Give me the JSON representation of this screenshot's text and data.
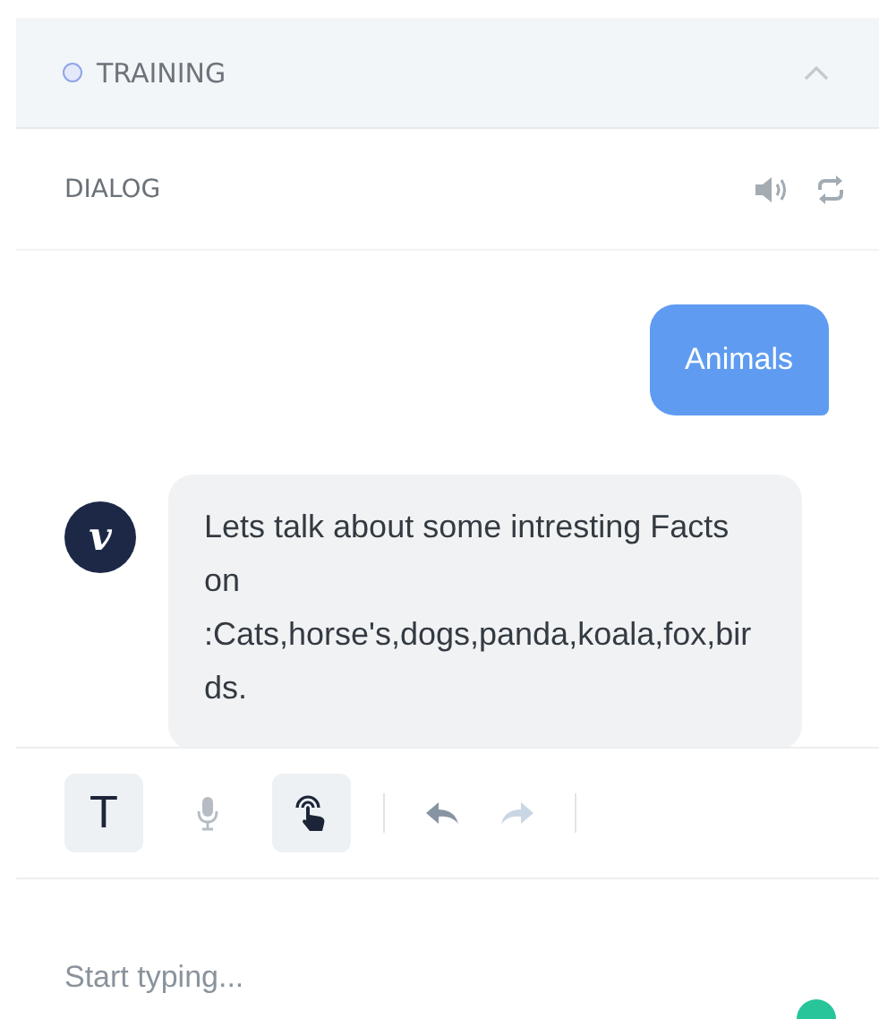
{
  "section": {
    "title": "TRAINING",
    "expanded": true
  },
  "dialog": {
    "title": "DIALOG"
  },
  "messages": [
    {
      "kind": "user",
      "text": "Animals"
    },
    {
      "kind": "bot",
      "avatar": "v",
      "text": "Lets talk about some intresting Facts on :Cats,horse's,dogs,panda,koala,fox,birds."
    }
  ],
  "toolbar": {
    "modes": [
      {
        "kind": "text",
        "label": "T",
        "selected": true
      },
      {
        "kind": "mic",
        "selected": false
      },
      {
        "kind": "touch",
        "selected": true
      }
    ],
    "history": [
      {
        "kind": "undo",
        "disabled": false
      },
      {
        "kind": "redo",
        "disabled": true
      }
    ]
  },
  "input": {
    "placeholder": "Start typing..."
  }
}
